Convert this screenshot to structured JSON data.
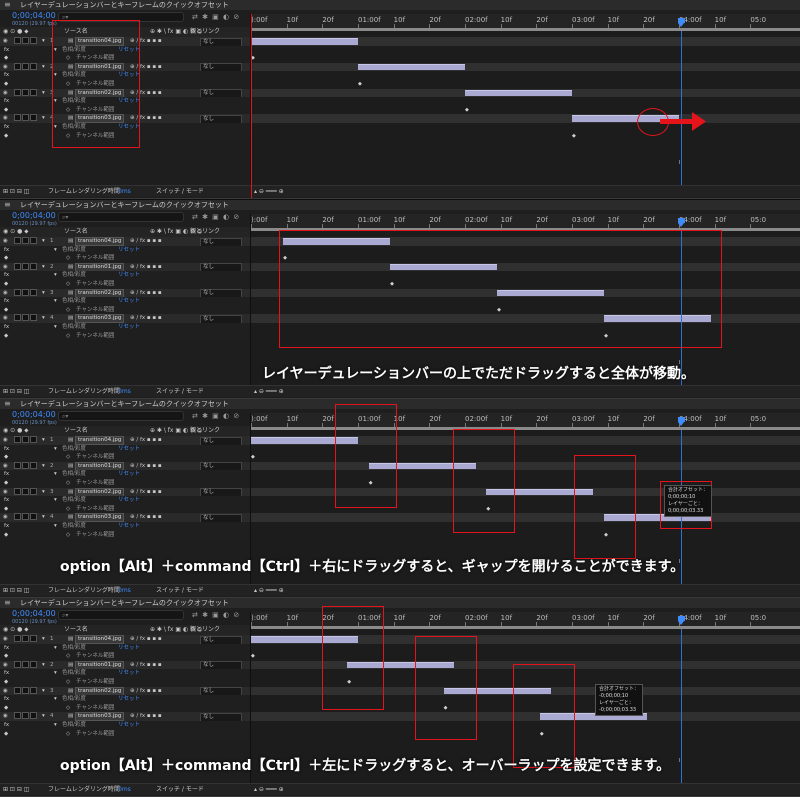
{
  "app": {
    "panel_title": "レイヤーデュレーションバーとキーフレームのクイックオフセット",
    "timecode": "0;00;04;00",
    "fps": "00120 (29.97 fps)",
    "search_placeholder": "⌕▾",
    "close_glyph": "≡"
  },
  "header": {
    "source_name": "ソース名",
    "parent_link": "親とリンク"
  },
  "ruler": {
    "ticks": [
      "):00f",
      "10f",
      "20f",
      "01:00f",
      "10f",
      "20f",
      "02:00f",
      "10f",
      "20f",
      "03:00f",
      "10f",
      "20f",
      "04:00f",
      "10f",
      "05:0"
    ]
  },
  "layers": [
    {
      "num": "1",
      "name": "transition04.jpg",
      "parent": "なし"
    },
    {
      "num": "2",
      "name": "transition01.jpg",
      "parent": "なし"
    },
    {
      "num": "3",
      "name": "transition02.jpg",
      "parent": "なし"
    },
    {
      "num": "4",
      "name": "transition03.jpg",
      "parent": "なし"
    }
  ],
  "props": {
    "effect": "色相/彩度",
    "reset": "リセット",
    "channel": "チャンネル範囲"
  },
  "bottom": {
    "render_label": "フレームレンダリング時間",
    "render_value": "0ms",
    "switch_mode": "スイッチ / モード"
  },
  "panels": [
    {
      "bars": [
        {
          "start": 0,
          "end": 1.0
        },
        {
          "start": 1.0,
          "end": 2.0
        },
        {
          "start": 2.0,
          "end": 3.0
        },
        {
          "start": 3.0,
          "end": 4.0
        }
      ],
      "keyframes": [
        0,
        1.0,
        2.0,
        3.0
      ],
      "caption": ""
    },
    {
      "bars": [
        {
          "start": 0.3,
          "end": 1.3
        },
        {
          "start": 1.3,
          "end": 2.3
        },
        {
          "start": 2.3,
          "end": 3.3
        },
        {
          "start": 3.3,
          "end": 4.3
        }
      ],
      "keyframes": [
        0.3,
        1.3,
        2.3,
        3.3
      ],
      "caption": "レイヤーデュレーションバーの上でただドラッグすると全体が移動。"
    },
    {
      "bars": [
        {
          "start": 0,
          "end": 1.0
        },
        {
          "start": 1.1,
          "end": 2.1
        },
        {
          "start": 2.2,
          "end": 3.2
        },
        {
          "start": 3.3,
          "end": 4.3
        }
      ],
      "keyframes": [
        0,
        1.1,
        2.2,
        3.3
      ],
      "caption": "option【Alt】＋command【Ctrl】＋右にドラッグすると、ギャップを開けることができます。",
      "tooltip": {
        "title": "合計オフセット：",
        "total": "0;00;00;10",
        "sub": "レイヤーごと：",
        "per": "0;00;00;03.33"
      }
    },
    {
      "bars": [
        {
          "start": 0,
          "end": 1.0
        },
        {
          "start": 0.9,
          "end": 1.9
        },
        {
          "start": 1.8,
          "end": 2.8
        },
        {
          "start": 2.7,
          "end": 3.7
        }
      ],
      "keyframes": [
        0,
        0.9,
        1.8,
        2.7
      ],
      "caption": "option【Alt】＋command【Ctrl】＋左にドラッグすると、オーバーラップを設定できます。",
      "tooltip": {
        "title": "合計オフセット：",
        "total": "-0;00;00;10",
        "sub": "レイヤーごと：",
        "per": "-0;00;00;03.33"
      }
    }
  ],
  "colors": {
    "accent": "#3f8cff",
    "bar": "#a9a9d2",
    "annotation": "#e5141b"
  }
}
